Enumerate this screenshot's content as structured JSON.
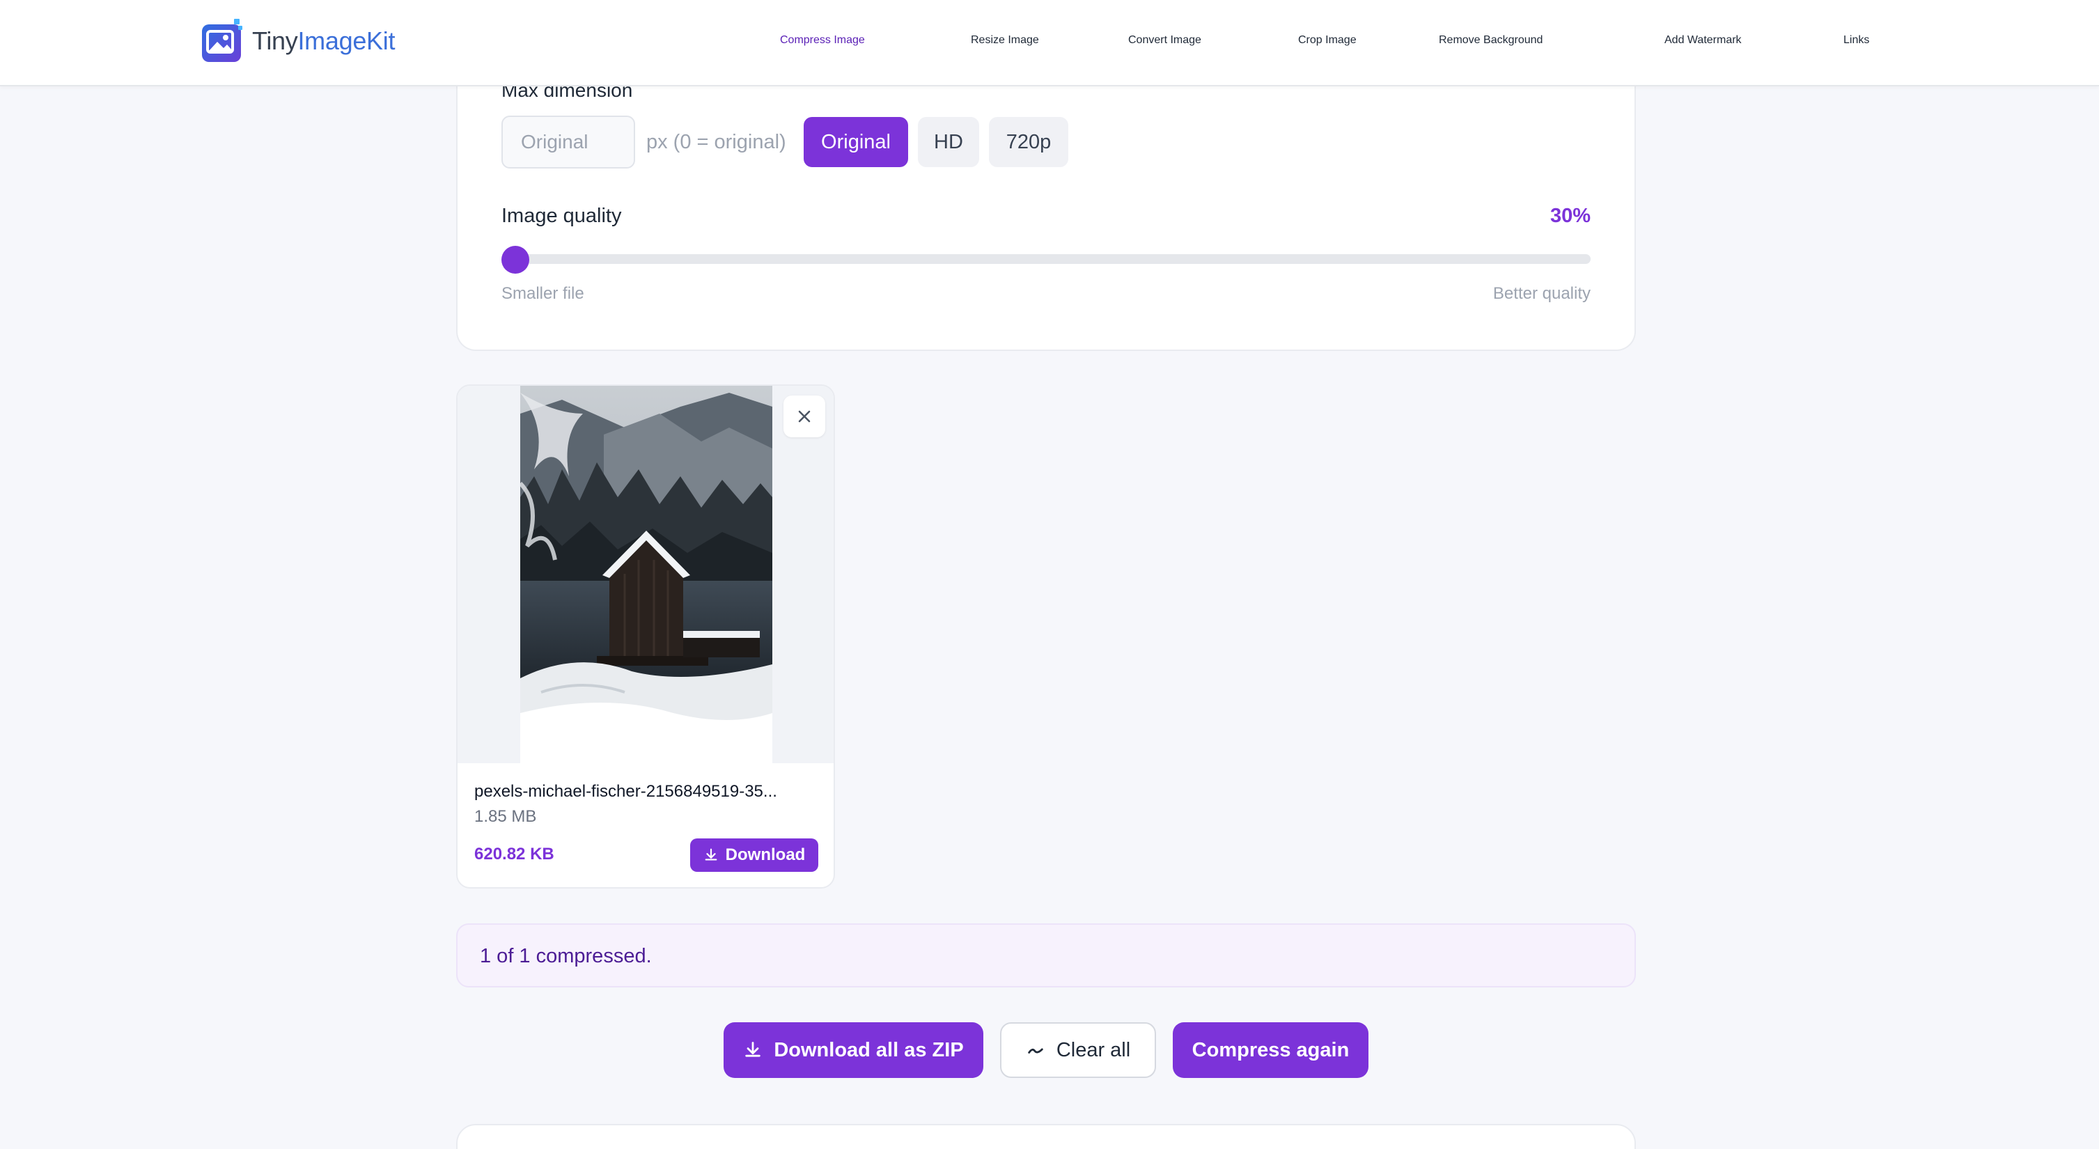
{
  "header": {
    "logo": {
      "text_plain": "Tiny",
      "text_accent": "ImageKit",
      "brand_color": "#3b6fd9"
    },
    "nav": [
      {
        "label": "Compress Image",
        "active": true
      },
      {
        "label": "Resize Image",
        "active": false
      },
      {
        "label": "Convert Image",
        "active": false
      },
      {
        "label": "Crop Image",
        "active": false
      },
      {
        "label": "Remove Background",
        "active": false
      },
      {
        "label": "Add Watermark",
        "active": false
      },
      {
        "label": "Links",
        "active": false
      }
    ]
  },
  "settings": {
    "max_dimension": {
      "label": "Max dimension",
      "value": "",
      "placeholder": "Original",
      "hint": "px (0 = original)",
      "presets": [
        {
          "label": "Original",
          "selected": true
        },
        {
          "label": "HD",
          "selected": false
        },
        {
          "label": "720p",
          "selected": false
        }
      ]
    },
    "quality": {
      "label": "Image quality",
      "value_text": "30%",
      "value": 30,
      "min_label": "Smaller file",
      "max_label": "Better quality"
    }
  },
  "files": [
    {
      "name": "pexels-michael-fischer-2156849519-35...",
      "original_size": "1.85 MB",
      "compressed_size": "620.82 KB",
      "download_label": "Download",
      "thumbnail_icon": "photo-snow-cabin"
    }
  ],
  "status": {
    "text": "1 of 1 compressed."
  },
  "actions": {
    "download_zip": "Download all as ZIP",
    "clear_all": "Clear all",
    "compress_again": "Compress again"
  },
  "colors": {
    "accent": "#7c33d9",
    "accent_text": "#5b21b6",
    "background": "#f6f7fb"
  }
}
